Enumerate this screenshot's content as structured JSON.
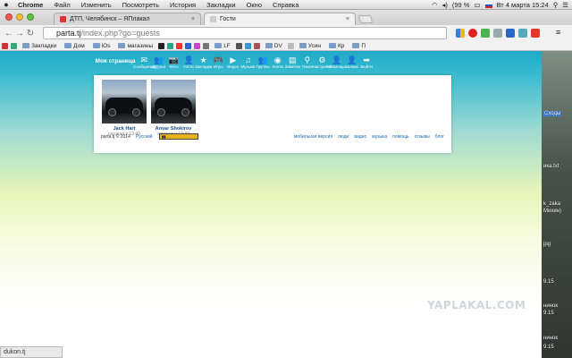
{
  "menubar": {
    "app": "Chrome",
    "items": [
      "Файл",
      "Изменить",
      "Посмотреть",
      "История",
      "Закладки",
      "Окно",
      "Справка"
    ],
    "battery": "(99 %",
    "clock": "Вт 4 марта  15:24"
  },
  "tabs": [
    {
      "label": "ДТП, Челябинск – ЯПлакал"
    },
    {
      "label": "Гости"
    }
  ],
  "url": {
    "host": "parta.tj",
    "path": "/index.php?go=guests"
  },
  "bookmarks": [
    {
      "label": "Закладки",
      "icon": "folder-icon"
    },
    {
      "label": "Дом",
      "icon": "folder-icon"
    },
    {
      "label": "iOs",
      "icon": "folder-icon"
    },
    {
      "label": "магазины",
      "icon": "folder-icon"
    },
    {
      "label": "LF",
      "icon": "folder-icon"
    },
    {
      "label": "DV",
      "icon": "folder-icon"
    },
    {
      "label": "Усин",
      "icon": "folder-icon"
    },
    {
      "label": "Кр",
      "icon": "folder-icon"
    },
    {
      "label": "П",
      "icon": "folder-icon"
    }
  ],
  "site": {
    "home_label": "Моя страница",
    "nav": [
      {
        "label": "Сообщения",
        "icon": "envelope-icon",
        "glyph": "✉"
      },
      {
        "label": "Друзья",
        "icon": "friends-icon",
        "glyph": "👥"
      },
      {
        "label": "Фото",
        "icon": "camera-icon",
        "glyph": "📷"
      },
      {
        "label": "Гости",
        "icon": "guest-icon",
        "glyph": "👤"
      },
      {
        "label": "Закладки",
        "icon": "star-icon",
        "glyph": "★"
      },
      {
        "label": "Игры",
        "icon": "gamepad-icon",
        "glyph": "🎮"
      },
      {
        "label": "Видео",
        "icon": "play-icon",
        "glyph": "▶"
      },
      {
        "label": "Музыка",
        "icon": "music-icon",
        "glyph": "♫"
      },
      {
        "label": "Группы",
        "icon": "group-icon",
        "glyph": "👥"
      },
      {
        "label": "Лента",
        "icon": "globe-icon",
        "glyph": "◉"
      },
      {
        "label": "Заметки",
        "icon": "note-icon",
        "glyph": "▤"
      },
      {
        "label": "Поиск",
        "icon": "search-icon",
        "glyph": "⚲"
      },
      {
        "label": "Настройки",
        "icon": "gear-icon",
        "glyph": "⚙"
      },
      {
        "label": "Помощь",
        "icon": "help-icon",
        "glyph": "👤"
      },
      {
        "label": "Баланс",
        "icon": "balance-icon",
        "glyph": "👤"
      },
      {
        "label": "Выйти",
        "icon": "exit-arrow-icon",
        "glyph": "➡"
      }
    ],
    "guests": [
      {
        "name": "Jack Hart",
        "time": "сегодня в 13:49"
      },
      {
        "name": "Anvar Shokirov",
        "time": "сегодня в 13:40"
      }
    ],
    "footer": {
      "copyright": "parta.tj © 2014",
      "language": "Русский",
      "links": [
        "мобильная версия",
        "люди",
        "видео",
        "музыка",
        "помощь",
        "отзывы",
        "блог"
      ]
    }
  },
  "watermark": "YAPLAKAL.COM",
  "status_url": "dukon.tj",
  "desktop_labels": [
    "Сходы",
    "ика.txt",
    "k_zaka",
    "Михин)",
    "jpg",
    "9.15",
    "нинок",
    "9.15",
    "нинок",
    "9.15"
  ]
}
